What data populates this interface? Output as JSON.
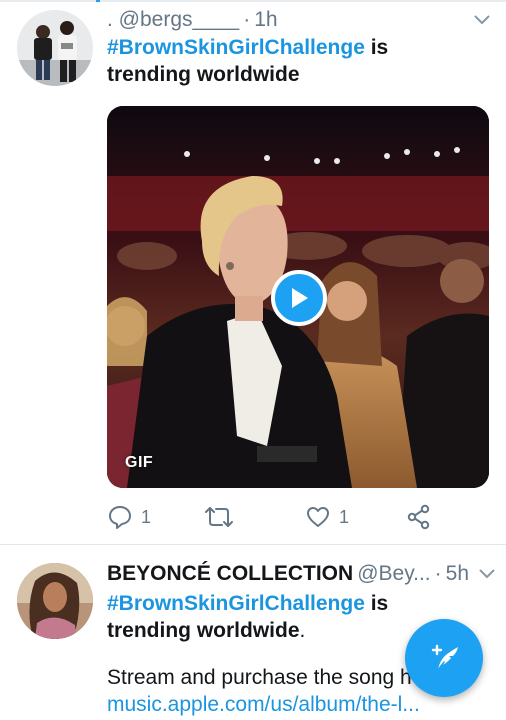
{
  "colors": {
    "accent": "#1da1f2",
    "link": "#1b95e0",
    "secondary_text": "#657786",
    "divider": "#e1e8ed"
  },
  "tweets": [
    {
      "display_name": "",
      "handle": ". @bergs____",
      "separator": "·",
      "time": "1h",
      "hashtag": "#BrownSkinGirlChallenge",
      "text_rest": " is trending worldwide",
      "media": {
        "type": "gif",
        "badge": "GIF",
        "icon": "play-icon"
      },
      "actions": {
        "reply_count": "1",
        "retweet_count": "",
        "like_count": "1"
      }
    },
    {
      "display_name": "BEYONCÉ COLLECTION",
      "handle": "@Bey...",
      "separator": "·",
      "time": "5h",
      "hashtag": "#BrownSkinGirlChallenge",
      "text_rest_bold": " is trending worldwide",
      "text_rest_tail": ".",
      "paragraph2": "Stream and purchase the song he",
      "link": "music.apple.com/us/album/the-l..."
    }
  ],
  "fab": {
    "icon": "compose-tweet-icon"
  }
}
